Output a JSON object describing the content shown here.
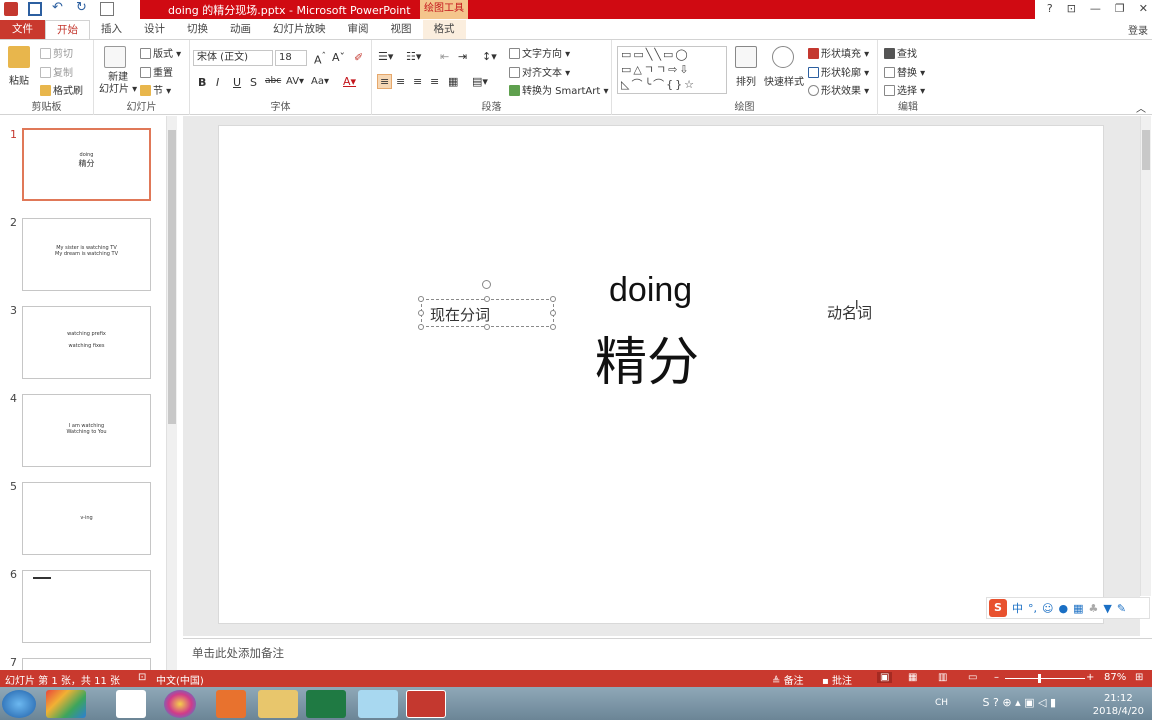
{
  "window": {
    "title": "doing 的精分现场.pptx - Microsoft PowerPoint",
    "context_tools": "绘图工具",
    "login": "登录"
  },
  "tabs": [
    {
      "label": "文件"
    },
    {
      "label": "开始"
    },
    {
      "label": "插入"
    },
    {
      "label": "设计"
    },
    {
      "label": "切换"
    },
    {
      "label": "动画"
    },
    {
      "label": "幻灯片放映"
    },
    {
      "label": "审阅"
    },
    {
      "label": "视图"
    },
    {
      "label": "格式"
    }
  ],
  "ribbon": {
    "clipboard": {
      "label": "剪贴板",
      "paste": "粘贴",
      "cut": "剪切",
      "copy": "复制",
      "format_painter": "格式刷"
    },
    "slides": {
      "label": "幻灯片",
      "new_slide": "新建\n幻灯片",
      "layout": "版式",
      "reset": "重置",
      "section": "节"
    },
    "font": {
      "label": "字体",
      "name": "宋体 (正文)",
      "size": "18"
    },
    "paragraph": {
      "label": "段落",
      "text_direction": "文字方向",
      "align_text": "对齐文本",
      "smartart": "转换为 SmartArt"
    },
    "drawing": {
      "label": "绘图",
      "arrange": "排列",
      "quick_styles": "快速样式",
      "fill": "形状填充",
      "outline": "形状轮廓",
      "effects": "形状效果"
    },
    "editing": {
      "label": "编辑",
      "find": "查找",
      "replace": "替换",
      "select": "选择"
    }
  },
  "thumbnails": [
    {
      "num": "1",
      "lines": [
        "doing",
        "精分"
      ]
    },
    {
      "num": "2",
      "lines": [
        "My sister is watching TV",
        "My dream is watching TV"
      ]
    },
    {
      "num": "3",
      "lines": [
        "watching prefix",
        "watching fixes"
      ]
    },
    {
      "num": "4",
      "lines": [
        "I am watching",
        "Watching to You"
      ]
    },
    {
      "num": "5",
      "lines": [
        "v-ing"
      ]
    },
    {
      "num": "6",
      "lines": [
        ""
      ]
    },
    {
      "num": "7",
      "lines": []
    }
  ],
  "slide": {
    "title": "doing",
    "big": "精分",
    "left_box": "现在分词",
    "right_text": "动名词"
  },
  "notes": "单击此处添加备注",
  "status": {
    "slide_info": "幻灯片 第 1 张，共 11 张",
    "language": "中文(中国)",
    "notes": "备注",
    "comments": "批注",
    "zoom": "87%"
  },
  "taskbar": {
    "lang": "CH",
    "time": "21:12",
    "date": "2018/4/20"
  },
  "ime": {
    "mode": "中"
  },
  "colors": {
    "accent": "#c9392e",
    "title_red": "#d00a12"
  }
}
